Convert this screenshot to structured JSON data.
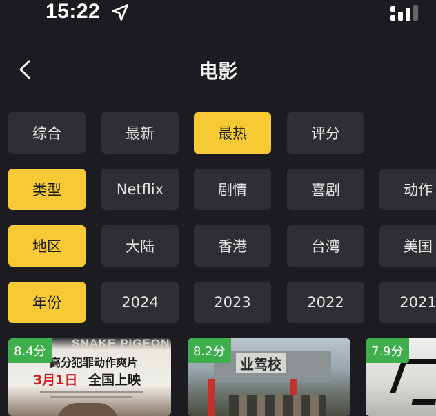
{
  "status": {
    "time": "15:22"
  },
  "nav": {
    "title": "电影"
  },
  "sort_row": {
    "items": [
      "综合",
      "最新",
      "最热",
      "评分"
    ],
    "active": 2
  },
  "type_row": {
    "label": "类型",
    "items": [
      "Netflix",
      "剧情",
      "喜剧",
      "动作"
    ]
  },
  "region_row": {
    "label": "地区",
    "items": [
      "大陆",
      "香港",
      "台湾",
      "美国"
    ]
  },
  "year_row": {
    "label": "年份",
    "items": [
      "2024",
      "2023",
      "2022",
      "2021"
    ]
  },
  "movies": [
    {
      "score": "8.4分",
      "poster_title": "SNAKE PIGEON",
      "poster_tagline": "高分犯罪动作爽片",
      "poster_date": "3月1日",
      "poster_release": "全国上映"
    },
    {
      "score": "8.2分",
      "poster_sign": "业驾校"
    },
    {
      "score": "7.9分"
    }
  ],
  "colors": {
    "accent": "#f6c935",
    "chip": "#2f2f33",
    "background": "#1c1c20",
    "score_badge": "#3fae4d"
  }
}
